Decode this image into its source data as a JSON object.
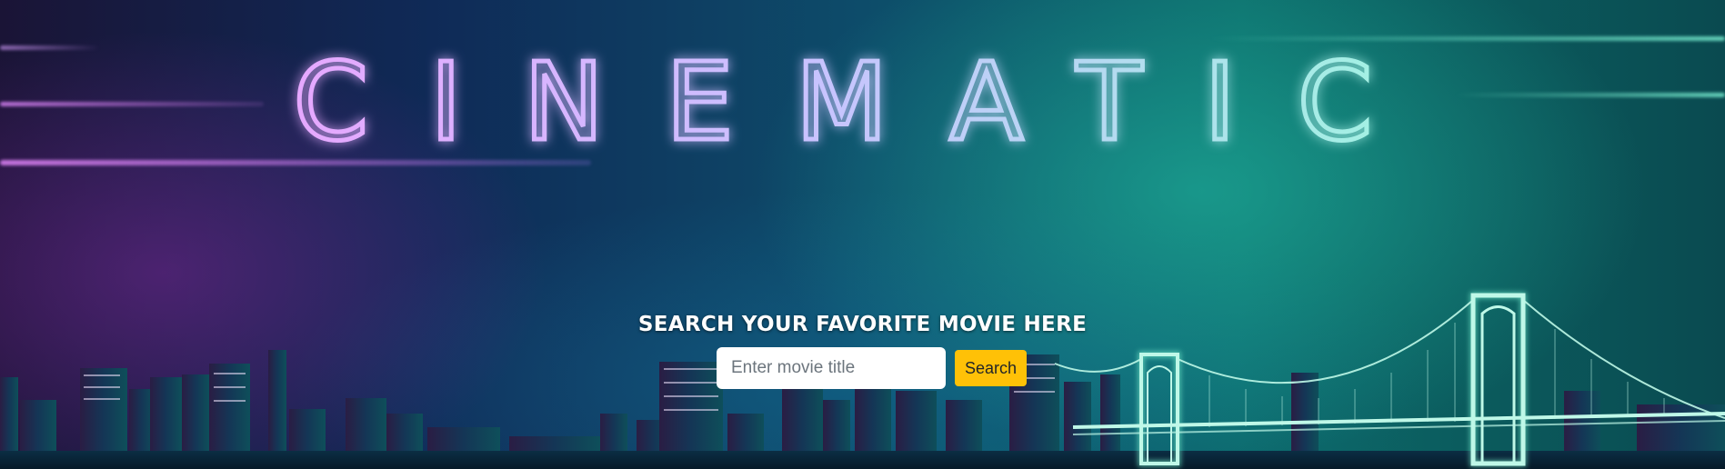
{
  "hero": {
    "brand_title": "CINEMATIC"
  },
  "search": {
    "heading": "SEARCH YOUR FAVORITE MOVIE HERE",
    "placeholder": "Enter movie title",
    "value": "",
    "button_label": "Search"
  },
  "colors": {
    "button_bg": "#ffc107",
    "neon_left": "#e6a8ff",
    "neon_right": "#9ff5e1",
    "heading_text": "#ffffff"
  },
  "icons": {
    "background": "city-skyline-bridge-night"
  }
}
